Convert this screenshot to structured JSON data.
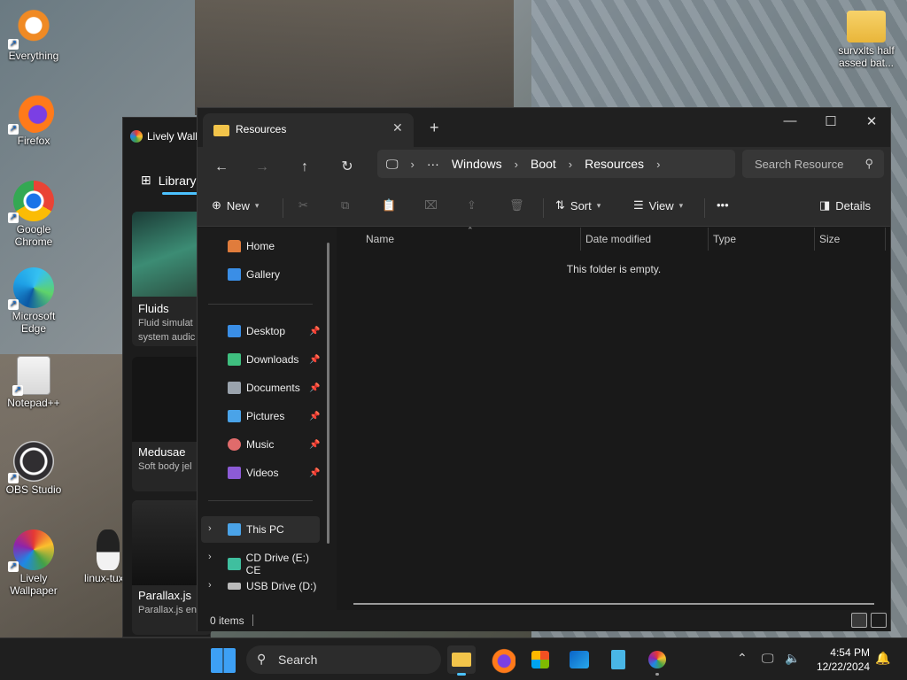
{
  "desktop": {
    "icons": [
      {
        "label": "Everything"
      },
      {
        "label": "Firefox"
      },
      {
        "label": "Google Chrome"
      },
      {
        "label": "Microsoft Edge"
      },
      {
        "label": "Notepad++"
      },
      {
        "label": "OBS Studio"
      },
      {
        "label": "Lively Wallpaper"
      },
      {
        "label": "linux-tux.c"
      },
      {
        "label": "survxlts half assed bat..."
      }
    ]
  },
  "lively": {
    "title": "Lively Wall",
    "library": "Library",
    "cards": [
      {
        "title": "Fluids",
        "line1": "Fluid simulat",
        "line2": "system audic"
      },
      {
        "title": "Medusae",
        "line1": "Soft body jel"
      },
      {
        "title": "Parallax.js",
        "line1": "Parallax.js en"
      }
    ]
  },
  "explorer": {
    "tab_title": "Resources",
    "address": [
      "Windows",
      "Boot",
      "Resources"
    ],
    "search_placeholder": "Search Resource",
    "toolbar": {
      "new": "New",
      "sort": "Sort",
      "view": "View",
      "more": "•••",
      "details": "Details"
    },
    "nav": {
      "home": "Home",
      "gallery": "Gallery",
      "pinned": [
        {
          "label": "Desktop",
          "icon": "desktop-icon",
          "color": "#3a8ee6"
        },
        {
          "label": "Downloads",
          "icon": "download-icon",
          "color": "#3fbf7f"
        },
        {
          "label": "Documents",
          "icon": "document-icon",
          "color": "#9aa3ad"
        },
        {
          "label": "Pictures",
          "icon": "pictures-icon",
          "color": "#4aa3e8"
        },
        {
          "label": "Music",
          "icon": "music-icon",
          "color": "#e06b6b"
        },
        {
          "label": "Videos",
          "icon": "videos-icon",
          "color": "#8c5bd6"
        }
      ],
      "drives": [
        {
          "label": "This PC",
          "icon": "this-pc-icon"
        },
        {
          "label": "CD Drive (E:) CE",
          "icon": "cd-drive-icon"
        },
        {
          "label": "USB Drive (D:)",
          "icon": "usb-drive-icon"
        }
      ]
    },
    "columns": [
      "Name",
      "Date modified",
      "Type",
      "Size"
    ],
    "empty_message": "This folder is empty.",
    "status_count": "0 items"
  },
  "taskbar": {
    "search_label": "Search",
    "time": "4:54 PM",
    "date": "12/22/2024"
  },
  "colors": {
    "accent": "#4cc2ff",
    "folder": "#f2c44a"
  }
}
